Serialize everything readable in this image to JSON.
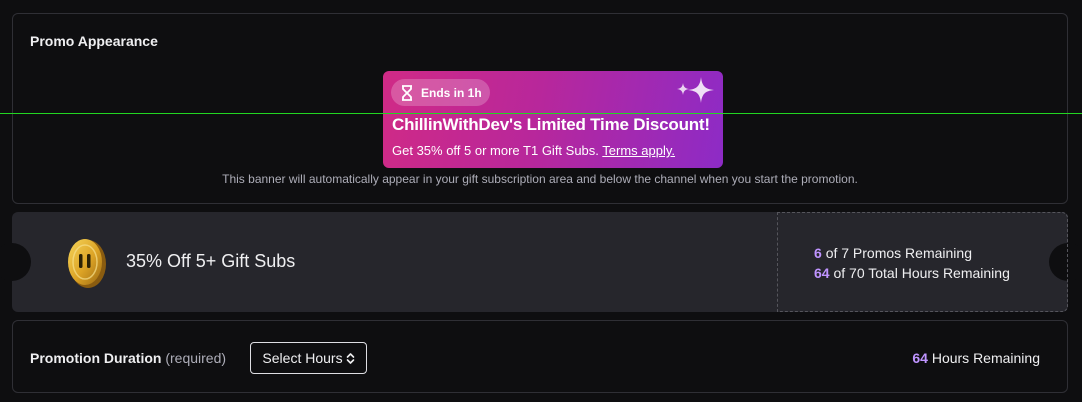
{
  "appearance": {
    "title": "Promo Appearance",
    "banner": {
      "ends_label": "Ends in 1h",
      "headline": "ChillinWithDev's Limited Time Discount!",
      "subtext": "Get 35% off 5 or more T1 Gift Subs.",
      "terms_link": "Terms apply."
    },
    "note": "This banner will automatically appear in your gift subscription area and below the channel when you start the promotion."
  },
  "ticket": {
    "title": "35% Off 5+ Gift Subs",
    "promos_remaining": "6",
    "promos_total_text": "of 7 Promos Remaining",
    "hours_remaining": "64",
    "hours_total_text": "of 70 Total Hours Remaining"
  },
  "duration": {
    "label": "Promotion Duration",
    "required_text": "(required)",
    "select_label": "Select Hours",
    "hours_remaining": "64",
    "hours_remaining_text": "Hours Remaining"
  },
  "colors": {
    "accent": "#bf94ff",
    "banner_start": "#d02a86",
    "banner_end": "#8d2bc6",
    "background": "#0e0e10",
    "ticket": "#26262c"
  }
}
